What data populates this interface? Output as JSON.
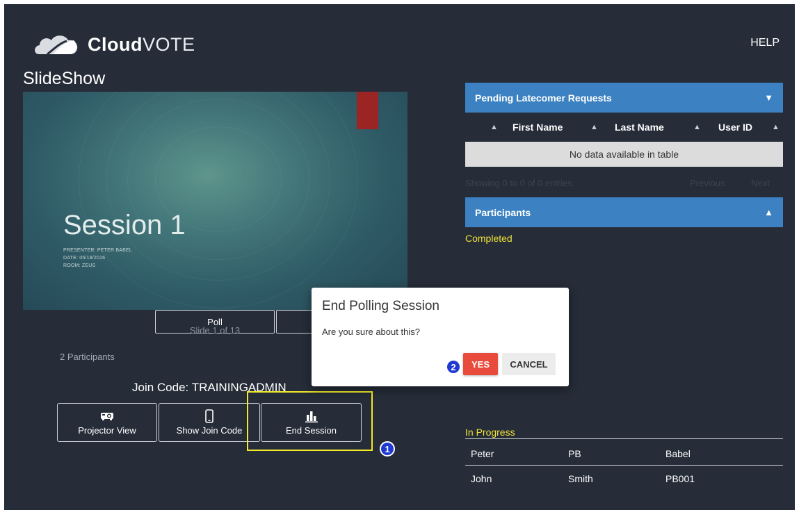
{
  "app": {
    "logo_bold": "Cloud",
    "logo_light": "VOTE",
    "help_label": "HELP"
  },
  "page": {
    "title": "SlideShow"
  },
  "slide": {
    "title": "Session 1",
    "presenter": "PRESENTER: PETER BABEL",
    "date": "DATE: 05/18/2016",
    "room": "ROOM: ZEUS",
    "accent_color": "#9b2424"
  },
  "controls": {
    "poll_label": "Poll",
    "slide_counter": "Slide 1 of 13",
    "participants_count": "2 Participants",
    "join_code": "Join Code: TRAININGADMIN",
    "projector_label": "Projector View",
    "show_join_label": "Show Join Code",
    "end_session_label": "End Session"
  },
  "annotations": {
    "step1": "1",
    "step2": "2",
    "highlight_color": "#f2eb2a",
    "badge_color": "#1f39d3"
  },
  "pending": {
    "header": "Pending Latecomer Requests",
    "columns": [
      "First Name",
      "Last Name",
      "User ID"
    ],
    "empty_text": "No data available in table",
    "info": "Showing 0 to 0 of 0 entries",
    "previous": "Previous",
    "next": "Next"
  },
  "participants_panel": {
    "header": "Participants",
    "completed_label": "Completed",
    "in_progress_label": "In Progress",
    "rows": [
      [
        "Peter",
        "PB",
        "Babel"
      ],
      [
        "John",
        "Smith",
        "PB001"
      ]
    ]
  },
  "dialog": {
    "title": "End Polling Session",
    "message": "Are you sure about this?",
    "yes": "YES",
    "cancel": "CANCEL"
  },
  "colors": {
    "background": "#262c38",
    "panel_header": "#3c82c2",
    "status_text": "#f0e23a",
    "yes_button": "#e84b3c"
  }
}
